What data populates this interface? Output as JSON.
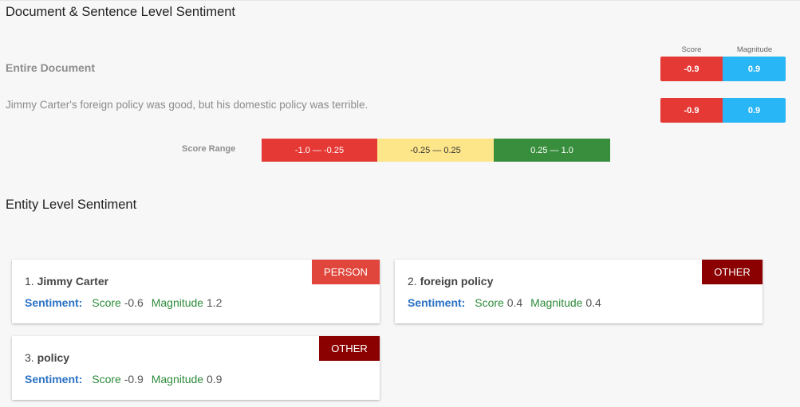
{
  "colors": {
    "negative": "#e53935",
    "magnitude": "#29b6f6",
    "neutral": "#fde58a",
    "positive": "#388e3c",
    "person_badge": "#e0463b",
    "other_badge": "#8b0000"
  },
  "document_section": {
    "title": "Document & Sentence Level Sentiment",
    "score_header": "Score",
    "magnitude_header": "Magnitude",
    "entire_document": {
      "label": "Entire Document",
      "score": "-0.9",
      "magnitude": "0.9"
    },
    "sentence": {
      "text": "Jimmy Carter's foreign policy was good, but his domestic policy was terrible.",
      "score": "-0.9",
      "magnitude": "0.9"
    },
    "score_range": {
      "label": "Score Range",
      "negative": "-1.0 — -0.25",
      "neutral": "-0.25 — 0.25",
      "positive": "0.25 — 1.0"
    }
  },
  "entity_section": {
    "title": "Entity Level Sentiment",
    "sentiment_label": "Sentiment:",
    "score_label": "Score",
    "magnitude_label": "Magnitude",
    "entities": [
      {
        "index": "1.",
        "name": "Jimmy Carter",
        "type": "PERSON",
        "score": "-0.6",
        "magnitude": "1.2"
      },
      {
        "index": "2.",
        "name": "foreign policy",
        "type": "OTHER",
        "score": "0.4",
        "magnitude": "0.4"
      },
      {
        "index": "3.",
        "name": "policy",
        "type": "OTHER",
        "score": "-0.9",
        "magnitude": "0.9"
      }
    ]
  }
}
